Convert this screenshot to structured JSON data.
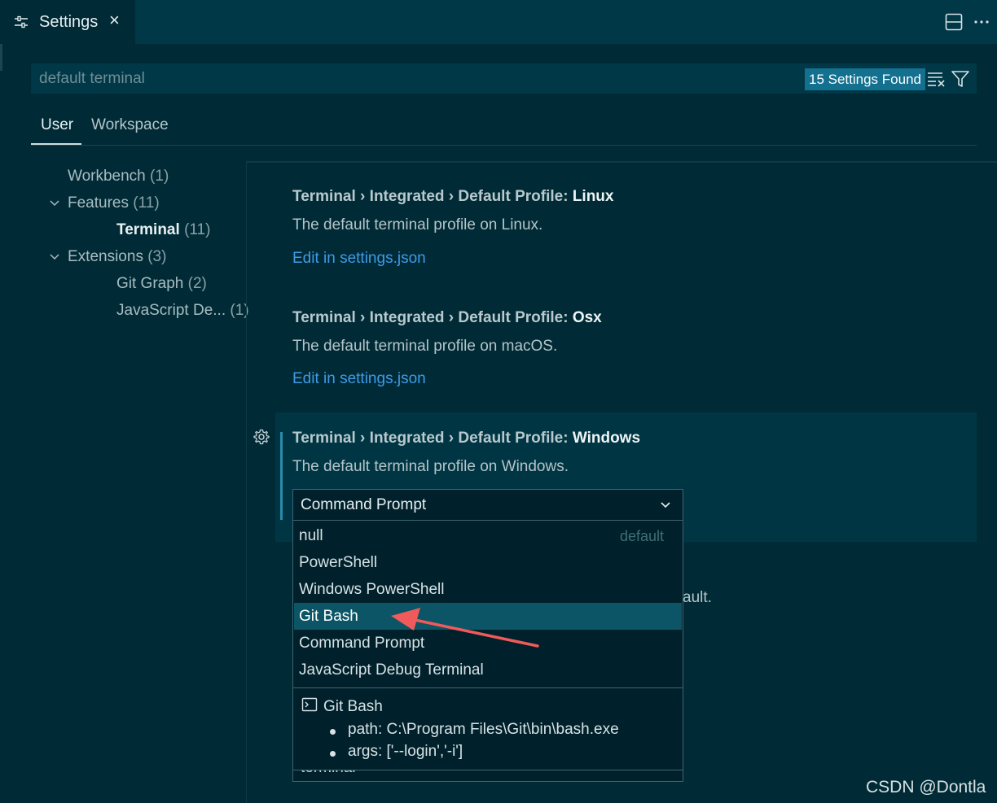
{
  "tab": {
    "title": "Settings",
    "close": "×"
  },
  "toolbar_actions": {
    "split": "split-editor-icon",
    "more": "more-actions-icon"
  },
  "search": {
    "value": "default terminal",
    "found": "15 Settings Found"
  },
  "scope_tabs": {
    "user": "User",
    "workspace": "Workspace"
  },
  "toc": [
    {
      "label": "Workbench",
      "count": "(1)"
    },
    {
      "label": "Features",
      "count": "(11)"
    },
    {
      "label": "Terminal",
      "count": "(11)"
    },
    {
      "label": "Extensions",
      "count": "(3)"
    },
    {
      "label": "Git Graph",
      "count": "(2)"
    },
    {
      "label": "JavaScript De...",
      "count": "(1)"
    }
  ],
  "settings": [
    {
      "category": "Terminal › Integrated › Default Profile: ",
      "key": "Linux",
      "desc": "The default terminal profile on Linux.",
      "link": "Edit in settings.json"
    },
    {
      "category": "Terminal › Integrated › Default Profile: ",
      "key": "Osx",
      "desc": "The default terminal profile on macOS.",
      "link": "Edit in settings.json"
    },
    {
      "category": "Terminal › Integrated › Default Profile: ",
      "key": "Windows",
      "desc": "The default terminal profile on Windows.",
      "value": "Command Prompt"
    }
  ],
  "partial": {
    "text_fragment": "ault.",
    "input_fragment": "terminal"
  },
  "dropdown": {
    "options": [
      {
        "label": "null",
        "note": "default"
      },
      {
        "label": "PowerShell"
      },
      {
        "label": "Windows PowerShell"
      },
      {
        "label": "Git Bash"
      },
      {
        "label": "Command Prompt"
      },
      {
        "label": "JavaScript Debug Terminal"
      }
    ],
    "selected": "Git Bash",
    "detail": {
      "title": "Git Bash",
      "path": "path: C:\\Program Files\\Git\\bin\\bash.exe",
      "args": "args: ['--login','-i']"
    }
  },
  "watermark": "CSDN @Dontla",
  "colors": {
    "background": "#002b36",
    "accent": "#13708f",
    "link": "#3f9ae6",
    "selected": "#0b5566",
    "arrow": "#f05a5a"
  }
}
